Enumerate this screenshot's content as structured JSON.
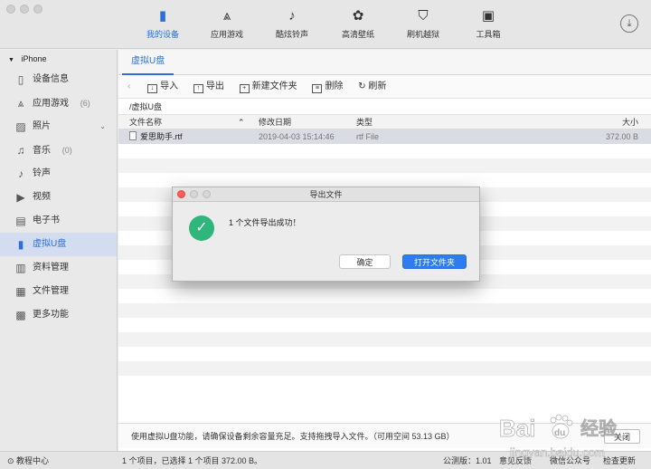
{
  "topnav": {
    "items": [
      {
        "label": "我的设备",
        "icon": "phone-icon",
        "glyph": "▮",
        "active": true
      },
      {
        "label": "应用游戏",
        "icon": "app-store-icon",
        "glyph": "⩓",
        "active": false
      },
      {
        "label": "酷炫铃声",
        "icon": "music-note-icon",
        "glyph": "♪",
        "active": false
      },
      {
        "label": "高清壁纸",
        "icon": "flower-icon",
        "glyph": "✿",
        "active": false
      },
      {
        "label": "刷机越狱",
        "icon": "shield-icon",
        "glyph": "⛉",
        "active": false
      },
      {
        "label": "工具箱",
        "icon": "toolbox-icon",
        "glyph": "▣",
        "active": false
      }
    ],
    "download_glyph": "⤓"
  },
  "sidebar": {
    "device_name": "iPhone",
    "items": [
      {
        "label": "设备信息",
        "icon": "info-icon",
        "glyph": "▯",
        "count": "",
        "chevron": ""
      },
      {
        "label": "应用游戏",
        "icon": "apps-icon",
        "glyph": "⩓",
        "count": "(6)",
        "chevron": ""
      },
      {
        "label": "照片",
        "icon": "photo-icon",
        "glyph": "▨",
        "count": "",
        "chevron": "⌄"
      },
      {
        "label": "音乐",
        "icon": "music-icon",
        "glyph": "♫",
        "count": "(0)",
        "chevron": ""
      },
      {
        "label": "铃声",
        "icon": "bell-icon",
        "glyph": "♪",
        "count": "",
        "chevron": ""
      },
      {
        "label": "视频",
        "icon": "video-icon",
        "glyph": "▶",
        "count": "",
        "chevron": ""
      },
      {
        "label": "电子书",
        "icon": "book-icon",
        "glyph": "▤",
        "count": "",
        "chevron": ""
      },
      {
        "label": "虚拟U盘",
        "icon": "usb-drive-icon",
        "glyph": "▮",
        "count": "",
        "chevron": "",
        "active": true
      },
      {
        "label": "资料管理",
        "icon": "contacts-icon",
        "glyph": "▥",
        "count": "",
        "chevron": ""
      },
      {
        "label": "文件管理",
        "icon": "file-manager-icon",
        "glyph": "▦",
        "count": "",
        "chevron": ""
      },
      {
        "label": "更多功能",
        "icon": "grid-icon",
        "glyph": "▩",
        "count": "",
        "chevron": ""
      }
    ]
  },
  "main": {
    "tab": "虚拟U盘",
    "toolbar": {
      "back": "‹",
      "import": "导入",
      "export": "导出",
      "new_folder": "新建文件夹",
      "delete": "删除",
      "refresh": "刷新"
    },
    "path": "/虚拟U盘",
    "columns": {
      "name": "文件名称",
      "date": "修改日期",
      "type": "类型",
      "size": "大小"
    },
    "files": [
      {
        "name": "爱思助手.rtf",
        "date": "2019-04-03 15:14:46",
        "type": "rtf File",
        "size": "372.00 B"
      }
    ],
    "bottom_note": "使用虚拟U盘功能，请确保设备剩余容量充足。支持拖拽导入文件。（可用空间 53.13 GB）",
    "close": "关闭"
  },
  "dialog": {
    "title": "导出文件",
    "message": "1 个文件导出成功！",
    "ok": "确定",
    "open_folder": "打开文件夹",
    "success_color": "#2fb67c"
  },
  "status": {
    "help": "教程中心",
    "selection": "1 个项目，已选择 1 个项目 372.00 B。",
    "version": "公测版：1.01",
    "feedback": "意见反馈",
    "wechat": "微信公众号",
    "update": "检查更新"
  },
  "watermark": {
    "brand": "Bai",
    "brand2": "du",
    "cn": "经验",
    "url": "jingyan.baidu.com"
  },
  "colors": {
    "accent": "#2a6fdb",
    "primary_button": "#2d7cf0"
  }
}
